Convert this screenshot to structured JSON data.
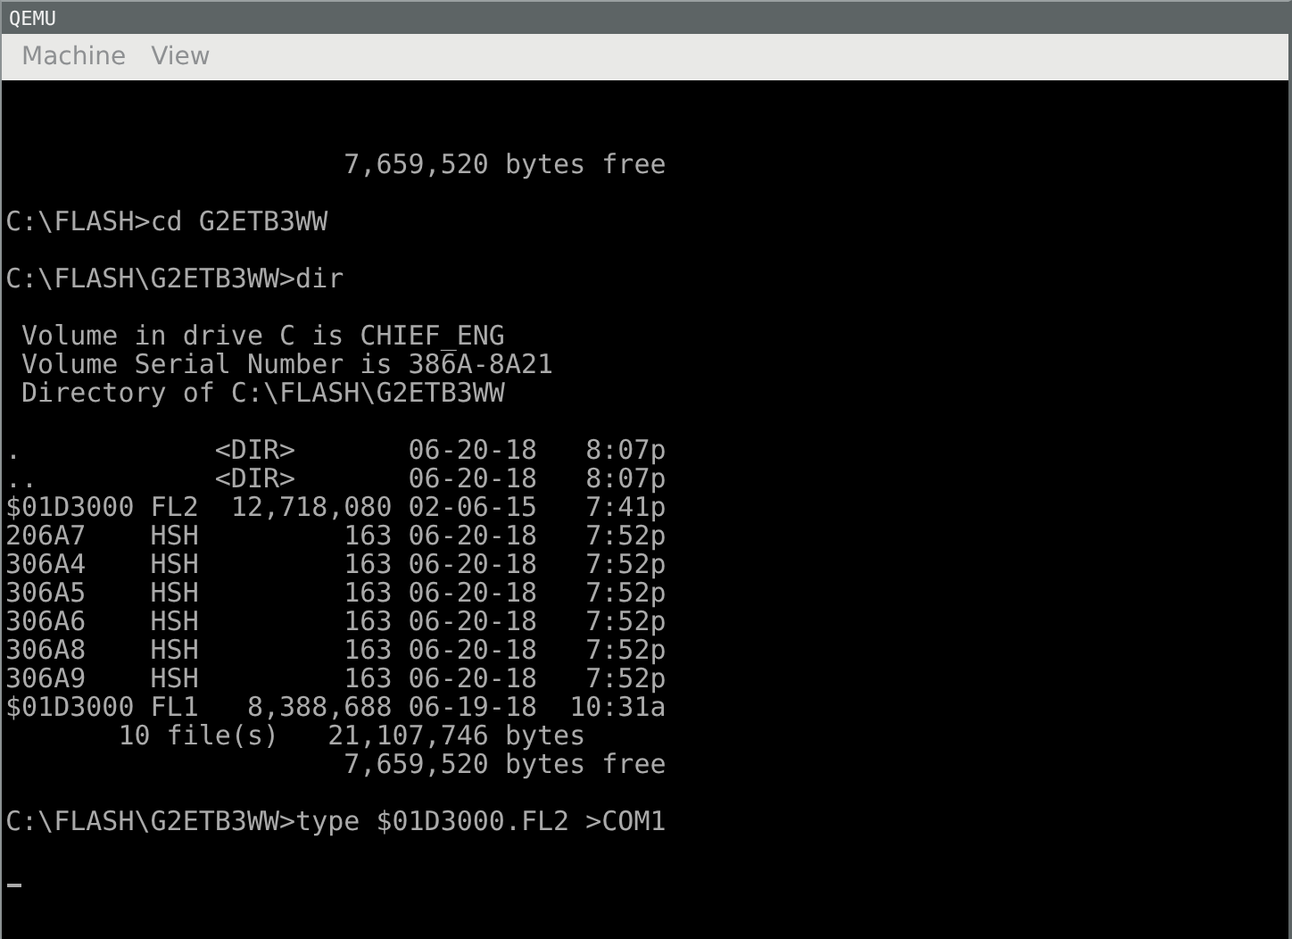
{
  "window": {
    "title": "QEMU"
  },
  "menu": [
    {
      "label": "Machine"
    },
    {
      "label": "View"
    }
  ],
  "console": {
    "blocks": [
      [
        "                     7,659,520 bytes free"
      ],
      [
        "C:\\FLASH>cd G2ETB3WW"
      ],
      [
        "C:\\FLASH\\G2ETB3WW>dir"
      ],
      [
        " Volume in drive C is CHIEF_ENG",
        " Volume Serial Number is 386A-8A21",
        " Directory of C:\\FLASH\\G2ETB3WW"
      ],
      [
        ".            <DIR>       06-20-18   8:07p",
        "..           <DIR>       06-20-18   8:07p",
        "$01D3000 FL2  12,718,080 02-06-15   7:41p",
        "206A7    HSH         163 06-20-18   7:52p",
        "306A4    HSH         163 06-20-18   7:52p",
        "306A5    HSH         163 06-20-18   7:52p",
        "306A6    HSH         163 06-20-18   7:52p",
        "306A8    HSH         163 06-20-18   7:52p",
        "306A9    HSH         163 06-20-18   7:52p",
        "$01D3000 FL1   8,388,688 06-19-18  10:31a",
        "       10 file(s)   21,107,746 bytes",
        "                     7,659,520 bytes free"
      ],
      [
        "C:\\FLASH\\G2ETB3WW>type $01D3000.FL2 >COM1"
      ]
    ],
    "cursor": true
  }
}
